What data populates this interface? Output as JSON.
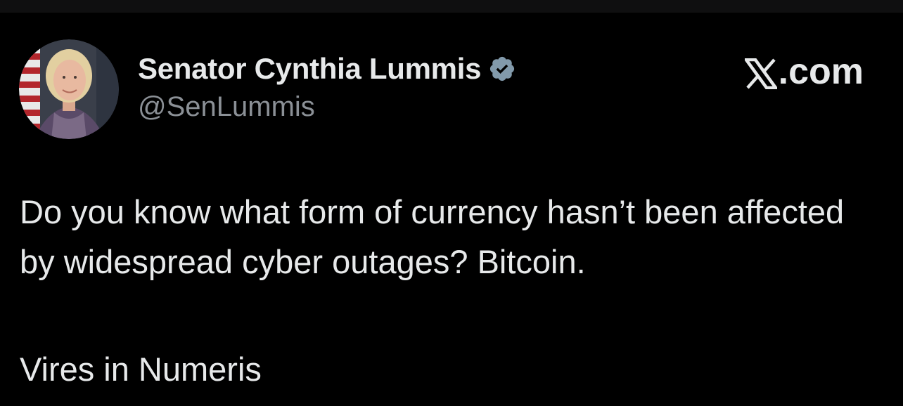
{
  "tweet": {
    "author": {
      "display_name": "Senator Cynthia Lummis",
      "handle": "@SenLummis",
      "verified_icon": "verified-badge-icon",
      "avatar_icon": "avatar-photo"
    },
    "brand": {
      "logo_icon": "x-logo-icon",
      "suffix": ".com"
    },
    "text": "Do you know what form of currency hasn’t been affected by widespread cyber outages? Bitcoin.",
    "motto": "Vires in Numeris"
  },
  "colors": {
    "background": "#000000",
    "text_primary": "#e7e9ea",
    "text_secondary": "#8b9096",
    "verified_badge": "#829aab"
  }
}
